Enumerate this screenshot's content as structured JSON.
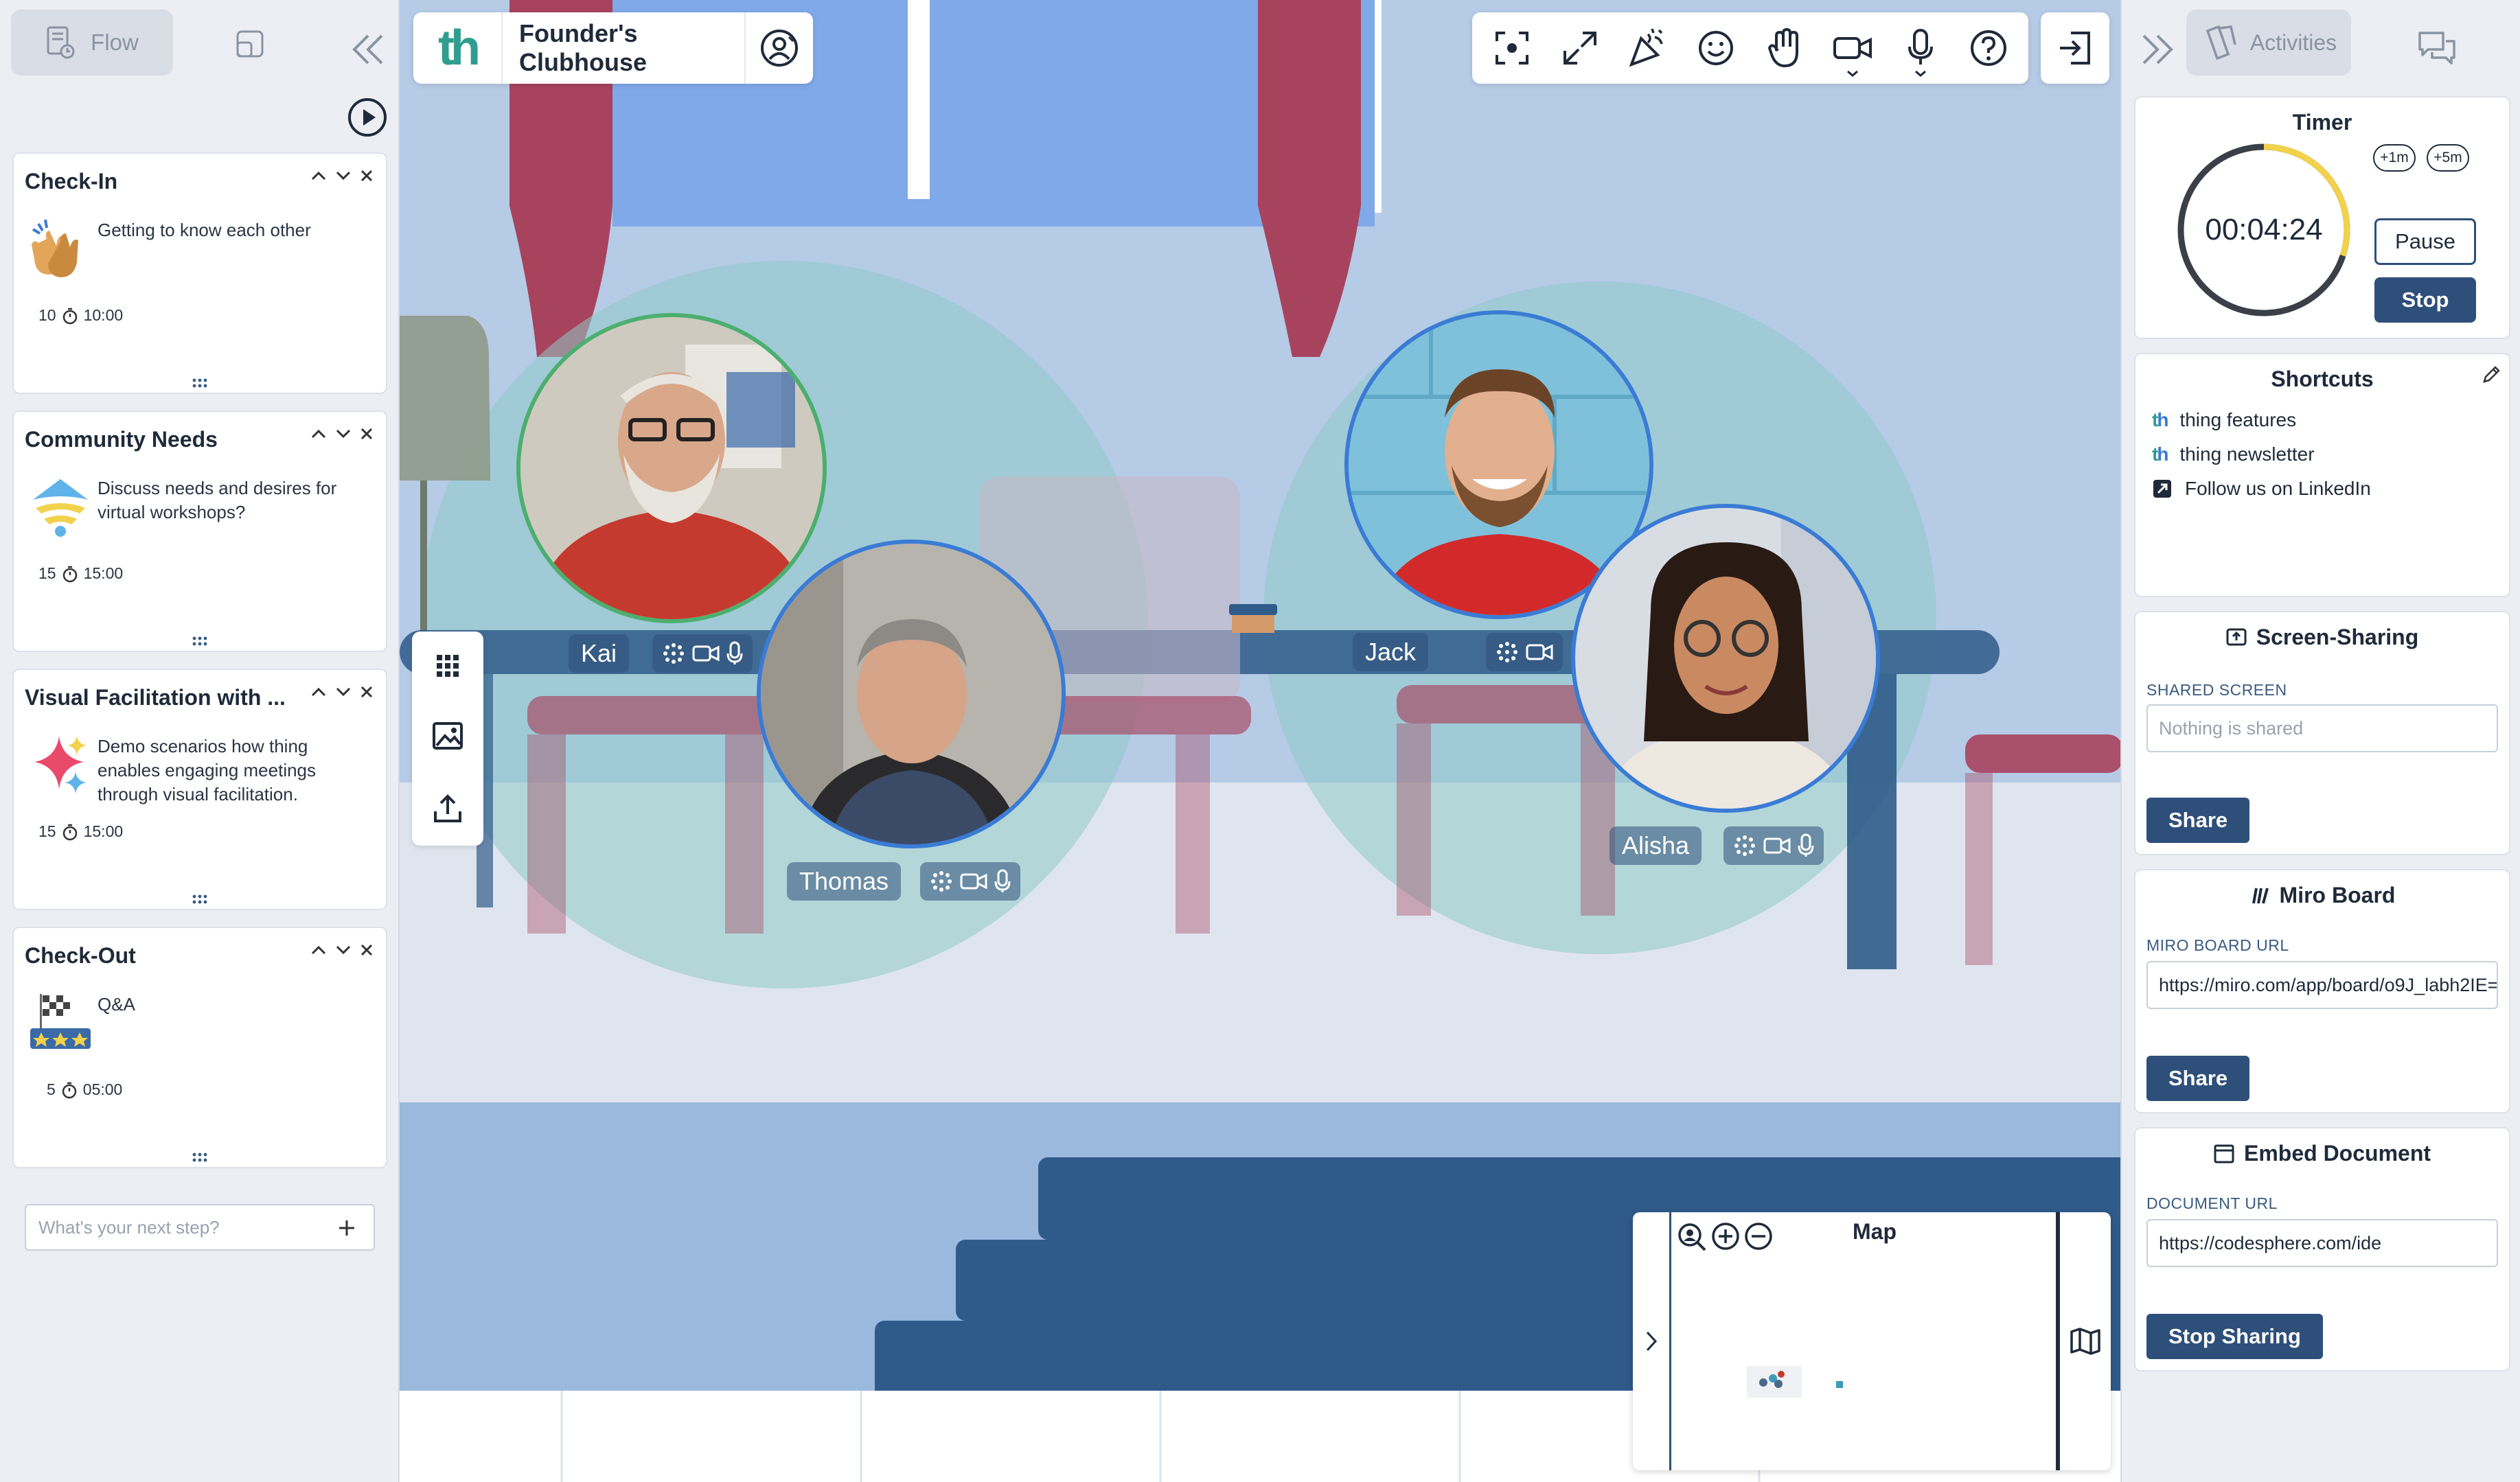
{
  "app": {
    "room_name": "Founder's Clubhouse",
    "logo_text": "th"
  },
  "left": {
    "tab_label": "Flow",
    "agenda": [
      {
        "title": "Check-In",
        "description": "Getting to know each other",
        "minutes": "10",
        "time": "10:00"
      },
      {
        "title": "Community Needs",
        "description": "Discuss needs and desires for virtual workshops?",
        "minutes": "15",
        "time": "15:00"
      },
      {
        "title": "Visual Facilitation with ...",
        "description": "Demo scenarios how thing enables engaging meetings through visual facilitation.",
        "minutes": "15",
        "time": "15:00"
      },
      {
        "title": "Check-Out",
        "description": "Q&A",
        "minutes": "5",
        "time": "05:00"
      }
    ],
    "next_step_placeholder": "What's your next step?"
  },
  "participants": [
    {
      "name": "Kai"
    },
    {
      "name": "Thomas"
    },
    {
      "name": "Jack"
    },
    {
      "name": "Alisha"
    }
  ],
  "map": {
    "title": "Map"
  },
  "right": {
    "tab_label": "Activities",
    "timer": {
      "title": "Timer",
      "display": "00:04:24",
      "chip1": "+1m",
      "chip2": "+5m",
      "pause_label": "Pause",
      "stop_label": "Stop",
      "progress": 0.3
    },
    "shortcuts": {
      "title": "Shortcuts",
      "items": [
        {
          "label": "thing features"
        },
        {
          "label": "thing newsletter"
        },
        {
          "label": "Follow us on LinkedIn"
        }
      ]
    },
    "screen_sharing": {
      "title": "Screen-Sharing",
      "field_label": "SHARED SCREEN",
      "placeholder": "Nothing is shared",
      "button": "Share"
    },
    "miro": {
      "title": "Miro Board",
      "field_label": "MIRO BOARD URL",
      "value": "https://miro.com/app/board/o9J_labh2IE=",
      "button": "Share"
    },
    "embed": {
      "title": "Embed Document",
      "field_label": "DOCUMENT URL",
      "value": "https://codesphere.com/ide",
      "button": "Stop Sharing"
    }
  },
  "colors": {
    "primary": "#2e4f7a",
    "logo_teal": "#2f9e8f",
    "logo_blue": "#3a7bd5",
    "timer_ring": "#f2d14b"
  }
}
